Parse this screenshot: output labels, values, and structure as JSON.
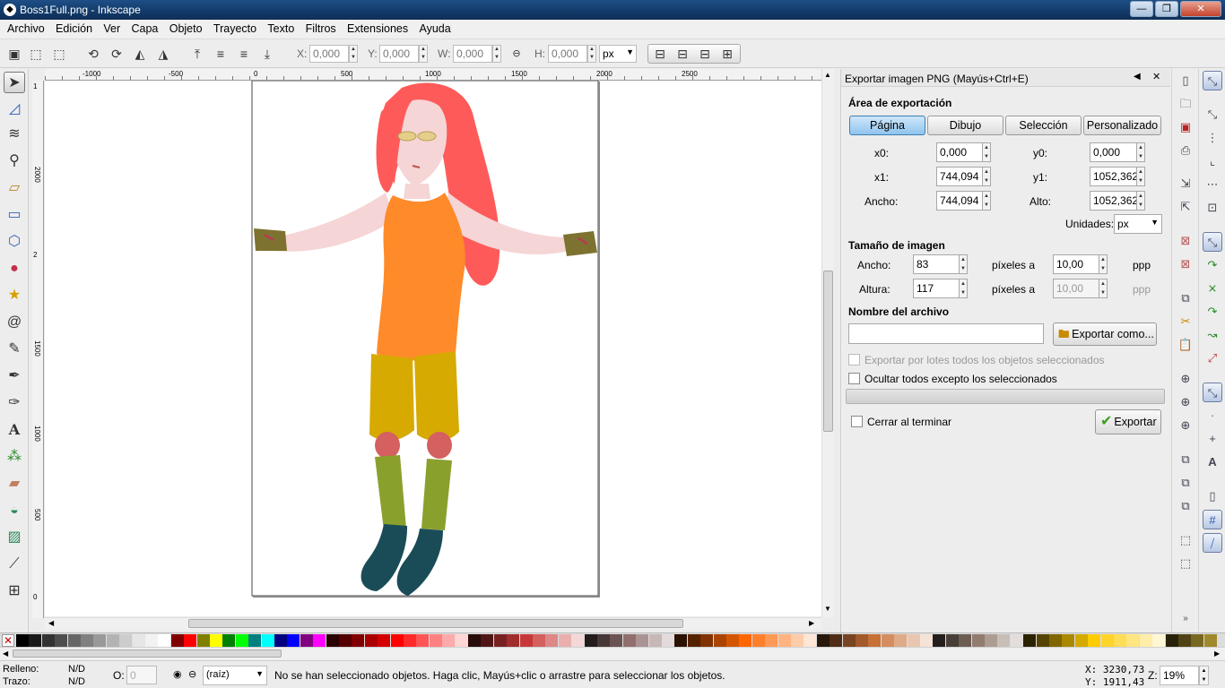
{
  "window": {
    "title": "Boss1Full.png - Inkscape",
    "minimize": "—",
    "maximize": "❐",
    "close": "✕"
  },
  "menu": [
    "Archivo",
    "Edición",
    "Ver",
    "Capa",
    "Objeto",
    "Trayecto",
    "Texto",
    "Filtros",
    "Extensiones",
    "Ayuda"
  ],
  "controls": {
    "x_label": "X:",
    "x_value": "0,000",
    "y_label": "Y:",
    "y_value": "0,000",
    "w_label": "W:",
    "w_value": "0,000",
    "h_label": "H:",
    "h_value": "0,000",
    "unit": "px"
  },
  "rulers": {
    "h_ticks": [
      "-1000",
      "-500",
      "0",
      "500",
      "1000",
      "1500",
      "2000",
      "2500"
    ],
    "v_ticks": [
      "1",
      "2000",
      "2",
      "1500",
      "1000",
      "500",
      "0"
    ]
  },
  "export": {
    "title": "Exportar imagen PNG (Mayús+Ctrl+E)",
    "area_heading": "Área de exportación",
    "area_buttons": [
      "Página",
      "Dibujo",
      "Selección",
      "Personalizado"
    ],
    "x0_label": "x0:",
    "x0": "0,000",
    "y0_label": "y0:",
    "y0": "0,000",
    "x1_label": "x1:",
    "x1": "744,094",
    "y1_label": "y1:",
    "y1": "1052,362",
    "width_label": "Ancho:",
    "width": "744,094",
    "height_label": "Alto:",
    "height": "1052,362",
    "units_label": "Unidades:",
    "units": "px",
    "size_heading": "Tamaño de imagen",
    "img_width_label": "Ancho:",
    "img_width": "83",
    "img_height_label": "Altura:",
    "img_height": "117",
    "pixels_at": "píxeles a",
    "dpi": "10,00",
    "dpi2": "10,00",
    "ppp": "ppp",
    "filename_heading": "Nombre del archivo",
    "filename": "",
    "export_as": "Exportar como...",
    "batch": "Exportar por lotes todos los objetos seleccionados",
    "hide_all": "Ocultar todos excepto los seleccionados",
    "close_when_done": "Cerrar al terminar",
    "export": "Exportar"
  },
  "status": {
    "fill_label": "Relleno:",
    "fill_value": "N/D",
    "stroke_label": "Trazo:",
    "stroke_value": "N/D",
    "opacity_label": "O:",
    "opacity_value": "0",
    "layer": "(raíz)",
    "message": "No se han seleccionado objetos. Haga clic, Mayús+clic o arrastre para seleccionar los objetos.",
    "x_coord": "X: 3230,73",
    "y_coord": "Y: 1911,43",
    "zoom_label": "Z:",
    "zoom": "19%"
  },
  "palette": [
    "#000000",
    "#1a1a1a",
    "#333333",
    "#4d4d4d",
    "#666666",
    "#808080",
    "#999999",
    "#b3b3b3",
    "#cccccc",
    "#e6e6e6",
    "#f2f2f2",
    "#ffffff",
    "#800000",
    "#ff0000",
    "#808000",
    "#ffff00",
    "#008000",
    "#00ff00",
    "#008080",
    "#00ffff",
    "#000080",
    "#0000ff",
    "#800080",
    "#ff00ff",
    "#2b0000",
    "#550000",
    "#800000",
    "#aa0000",
    "#d40000",
    "#ff0000",
    "#ff2a2a",
    "#ff5555",
    "#ff8080",
    "#ffaaaa",
    "#ffd5d5",
    "#280b0b",
    "#501616",
    "#782121",
    "#a02c2c",
    "#c83737",
    "#d35f5f",
    "#de8787",
    "#e9afaf",
    "#f4d7d7",
    "#241c1c",
    "#483737",
    "#6c5353",
    "#916f6f",
    "#ac9393",
    "#c8b7b7",
    "#e3dbdb",
    "#2b1100",
    "#552200",
    "#803300",
    "#aa4400",
    "#d45500",
    "#ff6600",
    "#ff7f2a",
    "#ff9955",
    "#ffb380",
    "#ffccaa",
    "#ffe6d5",
    "#28170b",
    "#502d16",
    "#784421",
    "#a05a2c",
    "#c87137",
    "#d38d5f",
    "#deaa87",
    "#e9c6af",
    "#f4e3d7",
    "#241f1c",
    "#483e37",
    "#6c5d53",
    "#917c6f",
    "#ac9d93",
    "#c8beb7",
    "#e3dedb",
    "#2b2200",
    "#554400",
    "#806600",
    "#aa8800",
    "#d4aa00",
    "#ffcc00",
    "#ffd42a",
    "#ffdd55",
    "#ffe680",
    "#ffeeaa",
    "#fff6d5",
    "#28220b",
    "#504416",
    "#786721",
    "#a0892c",
    "#c8ab37"
  ]
}
